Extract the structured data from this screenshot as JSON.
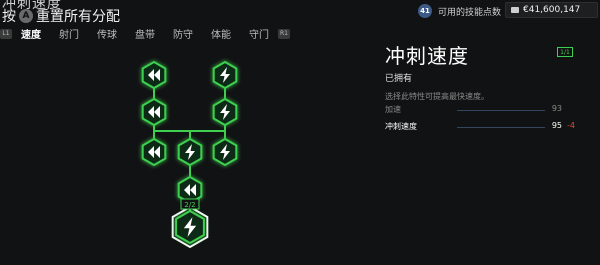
{
  "header": {
    "title_partial": "冲刺速度",
    "reset_button_glyph": "A",
    "reset_hint": "重置所有分配",
    "reset_prefix": "按"
  },
  "tabs": {
    "left_shoulder": "L1",
    "right_shoulder": "R1",
    "items": [
      "速度",
      "射门",
      "传球",
      "盘带",
      "防守",
      "体能",
      "守门"
    ],
    "active_index": 0
  },
  "currency": {
    "skill_points": "41",
    "skill_points_label": "可用的技能点数",
    "coins": "€41,600,147"
  },
  "skill_tree": {
    "colors": {
      "accent": "#3ecf4f",
      "node_fill": "#0f2a16",
      "link": "#3ecf4f"
    },
    "selected_node_progress": "2/2",
    "nodes": [
      {
        "id": "n1",
        "icon": "double-chevron-left-icon"
      },
      {
        "id": "n2",
        "icon": "lightning-icon"
      },
      {
        "id": "n3",
        "icon": "double-chevron-left-icon"
      },
      {
        "id": "n4",
        "icon": "lightning-icon"
      },
      {
        "id": "n5",
        "icon": "double-chevron-left-icon"
      },
      {
        "id": "n6",
        "icon": "lightning-icon"
      },
      {
        "id": "n7",
        "icon": "lightning-icon"
      },
      {
        "id": "n8",
        "icon": "double-chevron-left-icon"
      },
      {
        "id": "n9",
        "icon": "lightning-icon",
        "selected": true
      }
    ]
  },
  "detail": {
    "title": "冲刺速度",
    "level_badge": "1/1",
    "status": "已拥有",
    "description": "选择此特性可提高最快速度。",
    "stats": [
      {
        "name": "加速",
        "value": "93",
        "delta": ""
      },
      {
        "name": "冲刺速度",
        "value": "95",
        "delta": "-4"
      }
    ]
  }
}
